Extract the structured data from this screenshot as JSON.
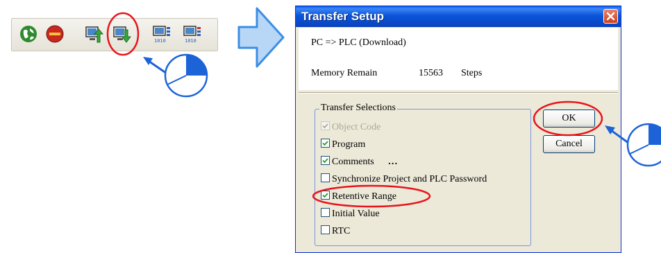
{
  "toolbar": {
    "buttons": [
      {
        "icon": "online-globe-icon"
      },
      {
        "icon": "stop-icon"
      },
      {
        "icon": "upload-from-plc-icon"
      },
      {
        "icon": "download-to-plc-icon",
        "highlighted": true
      },
      {
        "icon": "plc-monitor-icon"
      },
      {
        "icon": "plc-monitor-alt-icon"
      }
    ]
  },
  "dialog": {
    "title": "Transfer Setup",
    "direction": "PC => PLC (Download)",
    "memory_label": "Memory Remain",
    "memory_value": "15563",
    "memory_unit": "Steps",
    "group_title": "Transfer Selections",
    "options": [
      {
        "label": "Object Code",
        "checked": true,
        "disabled": true
      },
      {
        "label": "Program",
        "checked": true,
        "disabled": false
      },
      {
        "label": "Comments",
        "checked": true,
        "disabled": false,
        "extra": "…"
      },
      {
        "label": "Synchronize Project and PLC Password",
        "checked": false,
        "disabled": false
      },
      {
        "label": "Retentive Range",
        "checked": true,
        "disabled": false,
        "highlighted": true
      },
      {
        "label": "Initial Value",
        "checked": false,
        "disabled": false
      },
      {
        "label": "RTC",
        "checked": false,
        "disabled": false
      }
    ],
    "ok_label": "OK",
    "cancel_label": "Cancel"
  },
  "colors": {
    "title_bar": "#0a54d8",
    "dialog_bg": "#ece9d8",
    "highlight_red": "#e8141c",
    "callout_blue": "#1c63d8",
    "arrow_blue": "#3a8ee6"
  }
}
